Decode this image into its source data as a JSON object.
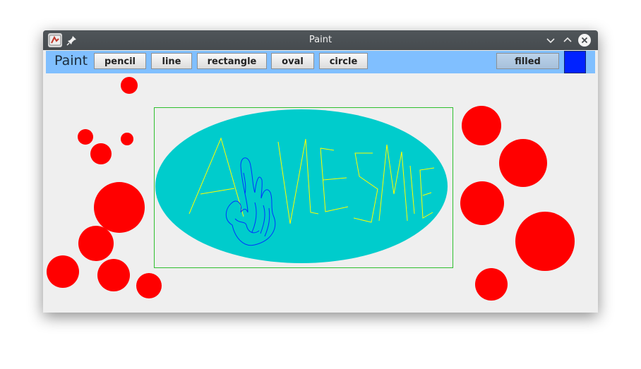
{
  "window": {
    "title": "Paint"
  },
  "toolbar": {
    "app_label": "Paint",
    "tools": [
      "pencil",
      "line",
      "rectangle",
      "oval",
      "circle"
    ],
    "filled_label": "filled",
    "current_color": "#0022ff"
  },
  "canvas": {
    "background": "#efefef",
    "shape_colors": {
      "circles": "#ff0000",
      "oval": "#00cccc",
      "rectangle": "#2fbf2f",
      "lines": "#ffff00",
      "pencil": "#0033ff"
    },
    "drawing_text": "AWESOME"
  },
  "icons": [
    "app-icon",
    "pin-icon",
    "minimize-icon",
    "maximize-icon",
    "close-icon"
  ]
}
